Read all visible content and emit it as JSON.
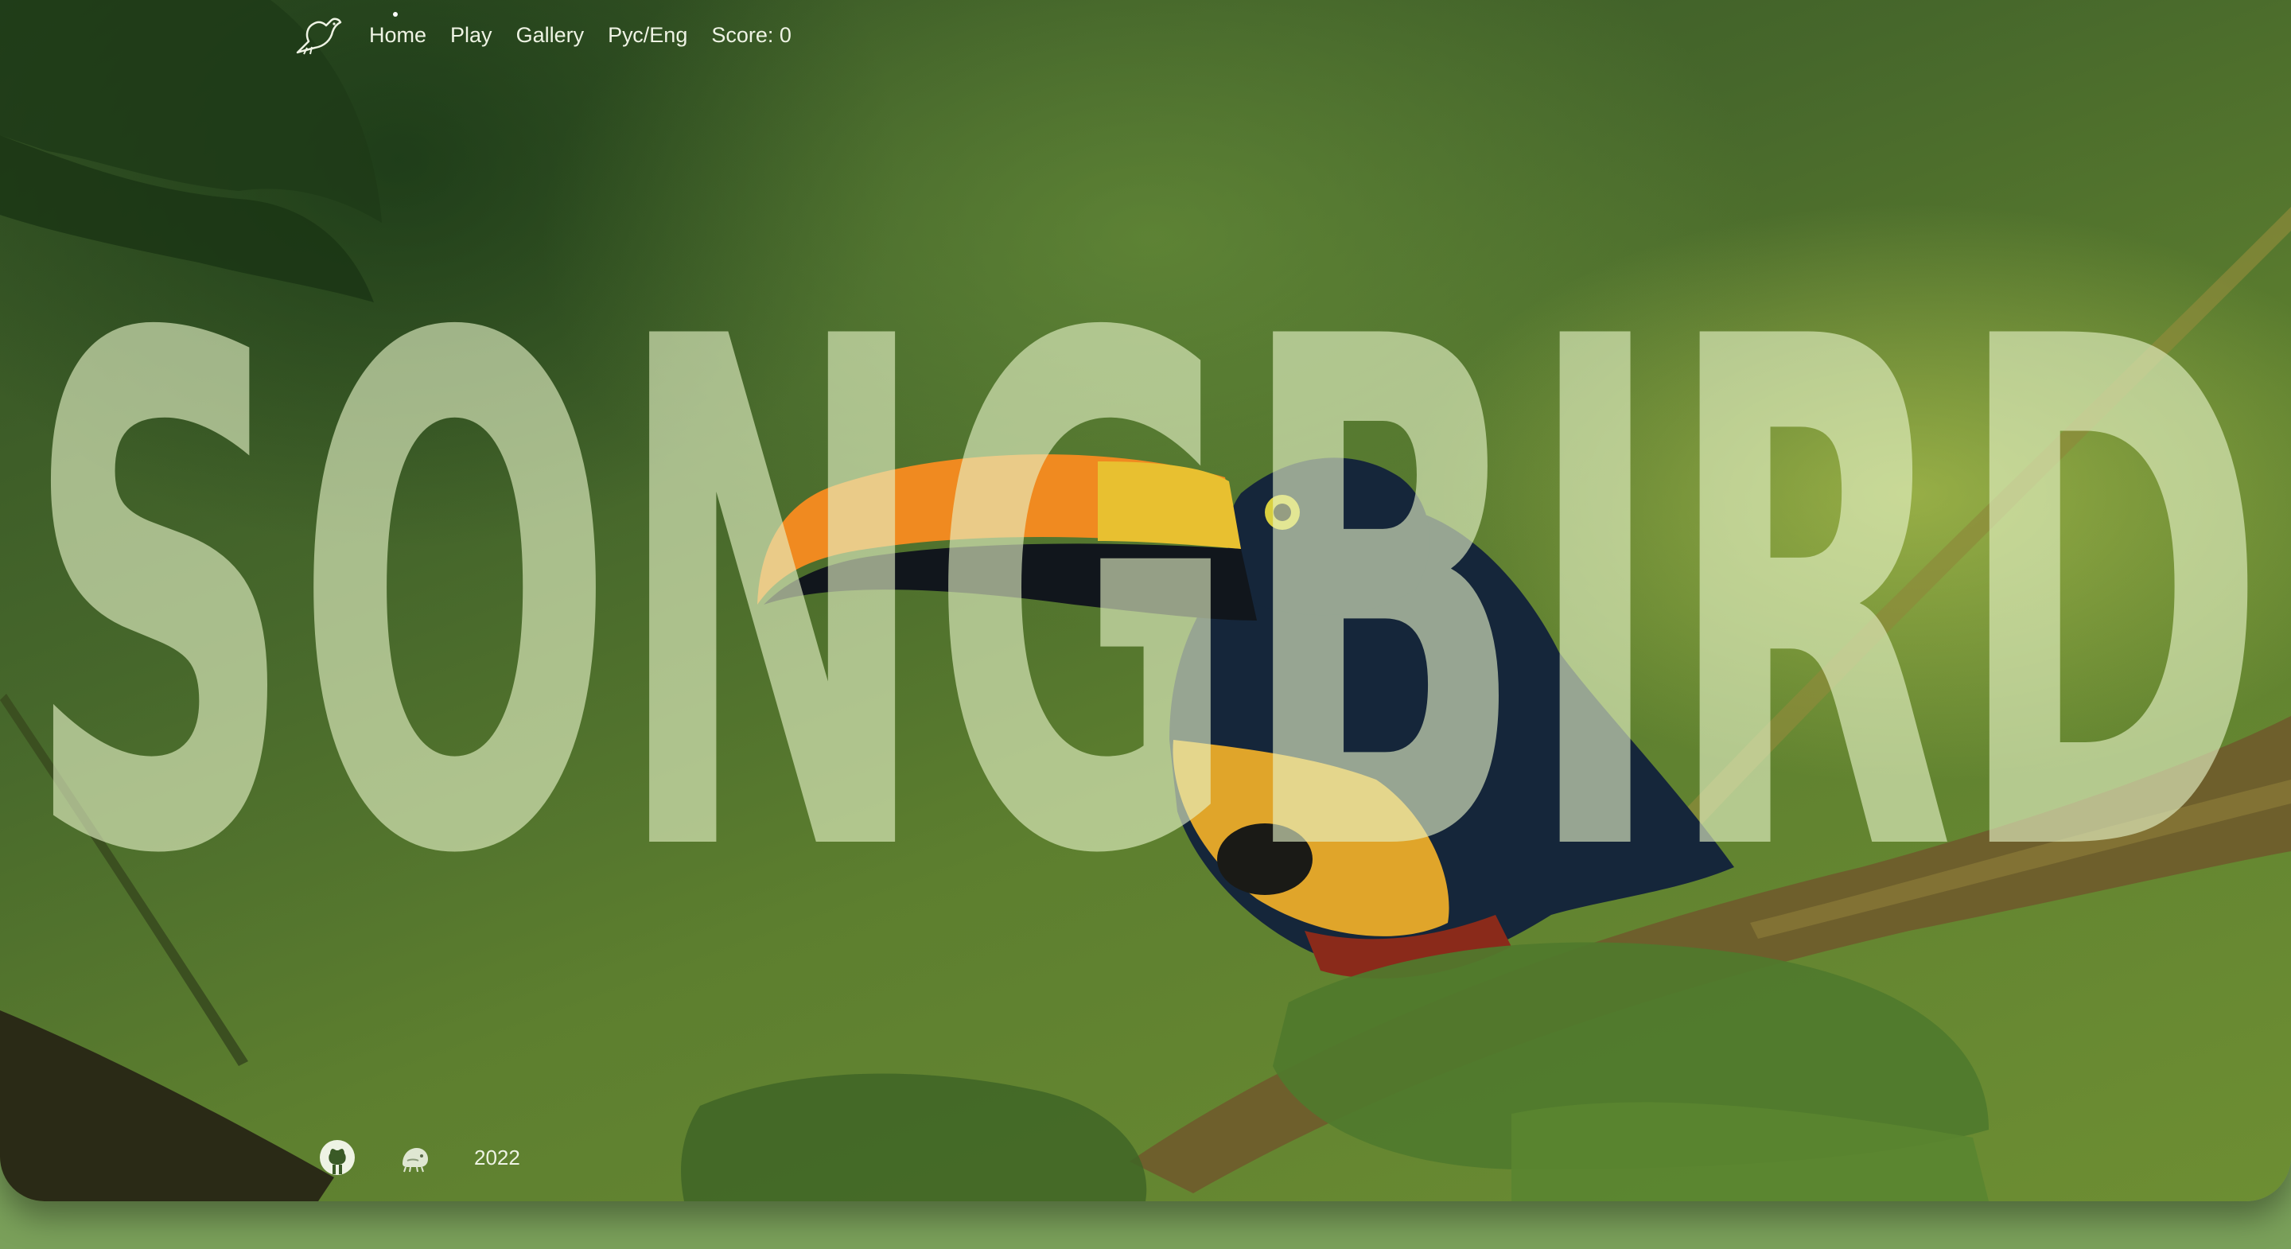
{
  "hero": {
    "title": "SONGBIRD"
  },
  "nav": {
    "items": [
      {
        "label": "Home",
        "active": true
      },
      {
        "label": "Play"
      },
      {
        "label": "Gallery"
      },
      {
        "label": "Рус/Eng"
      },
      {
        "label": "Score: 0"
      }
    ]
  },
  "footer": {
    "year": "2022",
    "icons": [
      "github-icon",
      "rs-school-icon"
    ]
  },
  "colors": {
    "accent_text": "#eef3e4",
    "page_background": "#7aa05a"
  }
}
